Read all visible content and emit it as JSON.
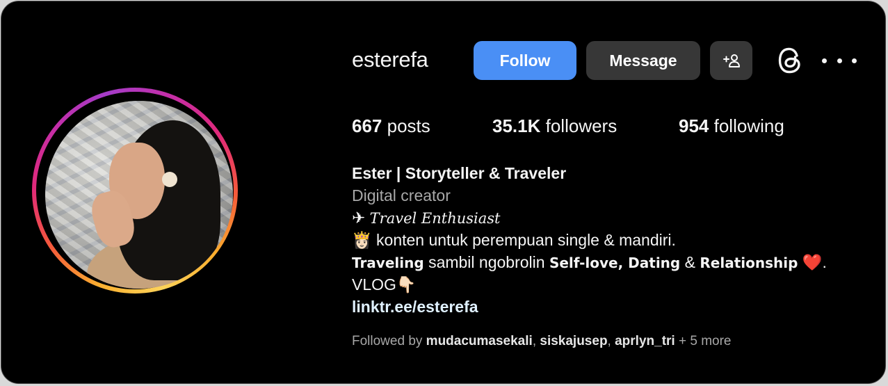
{
  "profile": {
    "username": "esterefa",
    "avatar_alt": "profile photo",
    "ring_colors": [
      "#fed35a",
      "#f55a3a",
      "#e0297a",
      "#a43cc8"
    ]
  },
  "actions": {
    "follow_label": "Follow",
    "follow_color": "#4a8ff5",
    "message_label": "Message",
    "add_icon": "add-person-icon",
    "threads_icon": "threads-icon",
    "more_icon": "more-options-icon"
  },
  "stats": {
    "posts_count": "667",
    "posts_label": "posts",
    "followers_count": "35.1K",
    "followers_label": "followers",
    "following_count": "954",
    "following_label": "following"
  },
  "bio": {
    "name": "Ester | Storyteller & Traveler",
    "category": "Digital creator",
    "line1_emoji": "✈",
    "line1_text": "Travel Enthusiast",
    "line2_emoji": "👸🏻",
    "line2_text": "konten untuk perempuan single & mandiri.",
    "line3_bold1": "Traveling",
    "line3_text1": "sambil ngobrolin",
    "line3_bold2": "Self-love, Dating",
    "line3_text2": "&",
    "line3_bold3": "Relationship",
    "line3_emoji": "❤️",
    "line3_end": ".",
    "line4_text": "VLOG",
    "line4_emoji": "👇🏻",
    "link": "linktr.ee/esterefa"
  },
  "followed_by": {
    "prefix": "Followed by",
    "user1": "mudacumasekali",
    "sep1": ",",
    "user2": "siskajusep",
    "sep2": ",",
    "user3": "aprlyn_tri",
    "more": "+ 5 more"
  }
}
